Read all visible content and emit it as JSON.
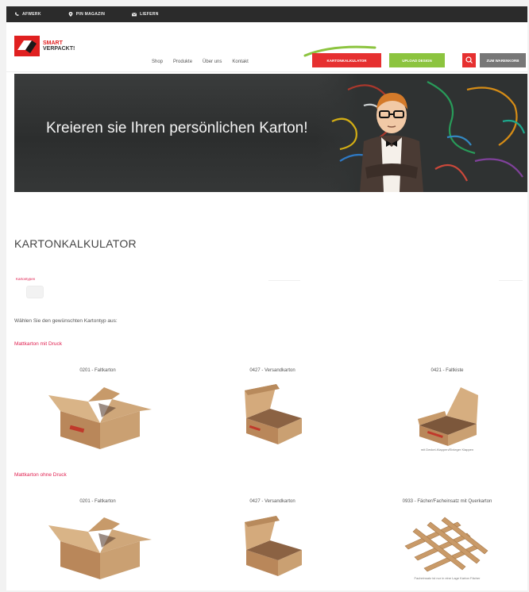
{
  "topbar": {
    "items": [
      {
        "icon": "phone-icon",
        "label": "AFWERK"
      },
      {
        "icon": "location-icon",
        "label": "PIN MAGAZIN"
      },
      {
        "icon": "mail-icon",
        "label": "LIEFERN"
      }
    ]
  },
  "header": {
    "logo_line1": "SMART",
    "logo_line2": "VERPACKT!",
    "nav": [
      "Shop",
      "Produkte",
      "Über uns",
      "Kontakt"
    ],
    "btn_calculator": "KARTONKALKULATOR",
    "btn_green": "UPLOAD DESIGN",
    "btn_grey": "ZUM WARENKORB"
  },
  "hero": {
    "headline": "Kreieren sie Ihren persönlichen Karton!"
  },
  "main": {
    "title": "KARTONKALKULATOR",
    "small_label": "Kartontypen",
    "intro": "Wählen Sie den gewünschten Kartontyp aus:",
    "categories": [
      {
        "label": "Mattkarton mit Druck",
        "products": [
          {
            "label": "0201 - Faltkarton",
            "caption": ""
          },
          {
            "label": "0427 - Versandkarton",
            "caption": ""
          },
          {
            "label": "0421 - Faltkiste",
            "caption": "mit Deckel-Klappen/Einleger Klappen"
          }
        ]
      },
      {
        "label": "Mattkarton ohne Druck",
        "products": [
          {
            "label": "0201 - Faltkarton",
            "caption": ""
          },
          {
            "label": "0427 - Versandkarton",
            "caption": ""
          },
          {
            "label": "0933 - Fächer/Facheinsatz mit Querkarton",
            "caption": "Facheinsatz ist nur in eine Lage Karton Fächer"
          }
        ]
      }
    ]
  },
  "colors": {
    "accent_red": "#e63030",
    "accent_green": "#8cc43f",
    "topbar": "#2b2b2b",
    "category_text": "#e02050"
  }
}
